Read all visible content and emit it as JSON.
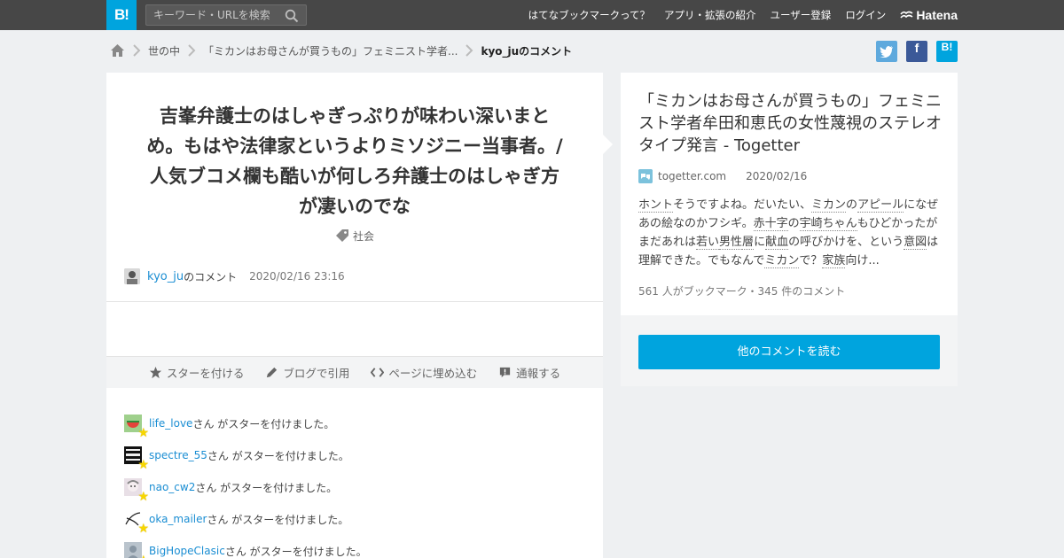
{
  "header": {
    "logo": "B!",
    "search_placeholder": "キーワード・URLを検索",
    "nav": [
      "はてなブックマークって？",
      "アプリ・拡張の紹介",
      "ユーザー登録",
      "ログイン"
    ],
    "brand": "Hatena"
  },
  "breadcrumb": {
    "items": [
      "世の中",
      "「ミカンはお母さんが買うもの」フェミニスト学者...",
      "kyo_juのコメント"
    ]
  },
  "share": {
    "twitter": "t",
    "facebook": "f",
    "hatena": "B!"
  },
  "comment": {
    "text": "吉峯弁護士のはしゃぎっぷりが味わい深いまとめ。もはや法律家というよりミソジニー当事者。/人気ブコメ欄も酷いが何しろ弁護士のはしゃぎ方が凄いのでな",
    "tag": "社会",
    "user": "kyo_ju",
    "user_suffix": "のコメント",
    "date": "2020/02/16 23:16"
  },
  "actions": [
    "スターを付ける",
    "ブログで引用",
    "ページに埋め込む",
    "通報する"
  ],
  "stars": {
    "suffix": "さん がスターを付けました。",
    "users": [
      "life_love",
      "spectre_55",
      "nao_cw2",
      "oka_mailer",
      "BigHopeClasic"
    ]
  },
  "entry": {
    "title": "「ミカンはお母さんが買うもの」フェミニスト学者牟田和恵氏の女性蔑視のステレオタイプ発言 - Togetter",
    "domain": "togetter.com",
    "date": "2020/02/16",
    "excerpt_parts": [
      "ホント",
      "そうですよね。だいたい、",
      "ミカン",
      "の",
      "アピール",
      "になぜあの絵なのかフシギ。",
      "赤十字",
      "の",
      "宇崎ちゃん",
      "もひどかったがまだあれは",
      "若い",
      "男性",
      "層",
      "に",
      "献血",
      "の呼びかけを、という",
      "意図",
      "は理解できた。でもなんで",
      "ミカン",
      "で？",
      "家族",
      "向け..."
    ],
    "counts": "561 人がブックマーク・345 件のコメント",
    "read_button": "他のコメントを読む"
  },
  "colors": {
    "brand": "#00a4de",
    "link": "#1b8ed3",
    "topbar": "#474747"
  }
}
